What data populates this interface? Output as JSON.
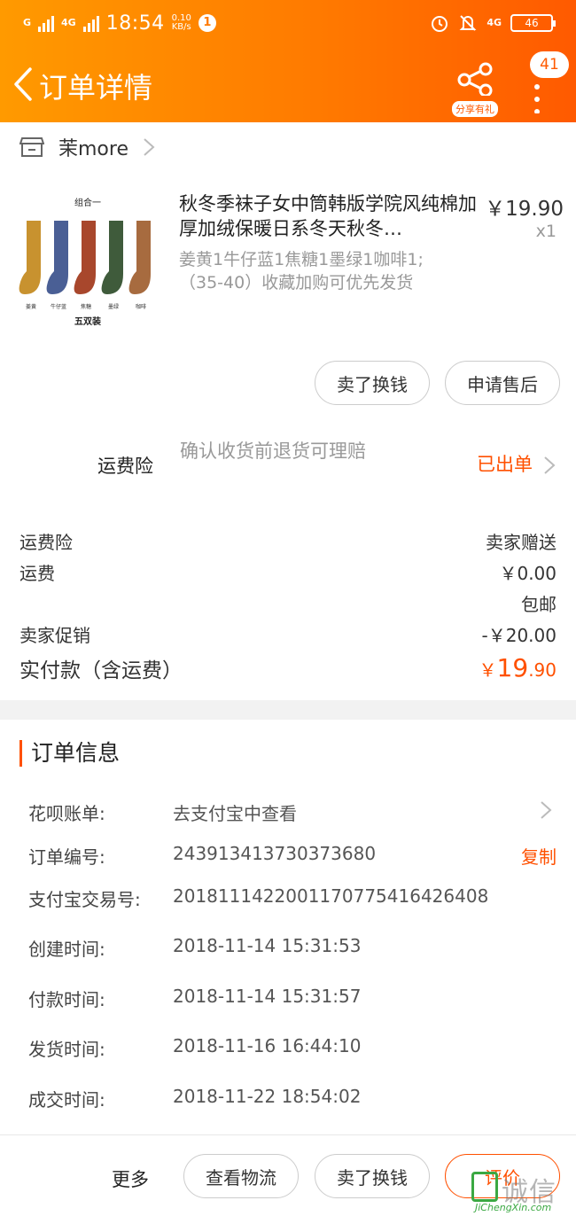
{
  "status_bar": {
    "network_left": "G",
    "network_mid": "4G",
    "time": "18:54",
    "speed_value": "0.10",
    "speed_unit": "KB/s",
    "notification_count": "1",
    "network_right": "4G",
    "battery": "46"
  },
  "navbar": {
    "title": "订单详情",
    "share_label": "分享有礼",
    "badge_count": "41"
  },
  "shop": {
    "name": "茉more"
  },
  "product": {
    "title": "秋冬季袜子女中筒韩版学院风纯棉加厚加绒保暖日系冬天秋冬…",
    "price": "￥19.90",
    "quantity": "x1",
    "sku": "姜黄1牛仔蓝1焦糖1墨绿1咖啡1;（35-40）收藏加购可优先发货",
    "image": {
      "combo_label": "组合一",
      "colors": [
        "姜黄",
        "牛仔蓝",
        "焦糖",
        "墨绿",
        "咖啡"
      ],
      "sock_colors": [
        "#c8922f",
        "#4a5f95",
        "#a8472c",
        "#3f5b3b",
        "#a76b3f"
      ],
      "pack_label": "五双装"
    },
    "btn_sell": "卖了换钱",
    "btn_after_sale": "申请售后"
  },
  "insurance": {
    "label": "运费险",
    "desc": "确认收货前退货可理赔",
    "status": "已出单"
  },
  "summary": {
    "rows": [
      {
        "label": "运费险",
        "value": "卖家赠送"
      },
      {
        "label": "运费",
        "value": "￥0.00"
      },
      {
        "label": "",
        "value": "包邮"
      },
      {
        "label": "卖家促销",
        "value": "-￥20.00"
      }
    ],
    "total_label": "实付款（含运费）",
    "total_symbol": "￥",
    "total_int": "19",
    "total_dec": ".90"
  },
  "order_info": {
    "title": "订单信息",
    "rows": [
      {
        "label": "花呗账单:",
        "value": "去支付宝中查看",
        "action": ""
      },
      {
        "label": "订单编号:",
        "value": "243913413730373680",
        "action": "复制"
      },
      {
        "label": "支付宝交易号:",
        "value": "2018111422001170775416426408",
        "action": ""
      },
      {
        "label": "创建时间:",
        "value": "2018-11-14 15:31:53",
        "action": ""
      },
      {
        "label": "付款时间:",
        "value": "2018-11-14 15:31:57",
        "action": ""
      },
      {
        "label": "发货时间:",
        "value": "2018-11-16 16:44:10",
        "action": ""
      },
      {
        "label": "成交时间:",
        "value": "2018-11-22 18:54:02",
        "action": ""
      }
    ]
  },
  "footer": {
    "more": "更多",
    "logistics": "查看物流",
    "sell": "卖了换钱",
    "review": "评价"
  },
  "watermark": {
    "zh": "诚信",
    "en": "JiChengXin.com"
  },
  "colors": {
    "accent": "#ff5000",
    "header_start": "#ff9a00",
    "header_end": "#ff5a00"
  }
}
